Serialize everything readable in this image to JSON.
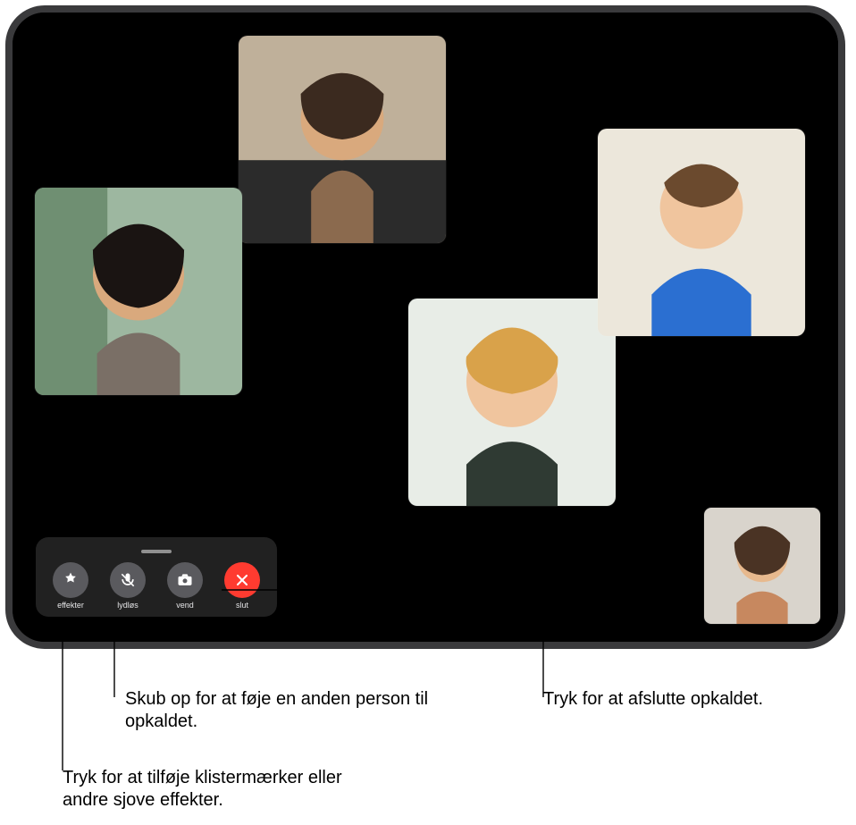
{
  "controls": {
    "effects": {
      "label": "effekter",
      "icon": "star-swirl-icon"
    },
    "mute": {
      "label": "lydløs",
      "icon": "mic-slash-icon"
    },
    "flip": {
      "label": "vend",
      "icon": "camera-flip-icon"
    },
    "end": {
      "label": "slut",
      "icon": "x-icon",
      "color": "#ff3b30"
    }
  },
  "participants": {
    "p1": {
      "desc": "participant-top"
    },
    "p2": {
      "desc": "participant-left"
    },
    "p3": {
      "desc": "participant-center"
    },
    "p4": {
      "desc": "participant-right"
    },
    "self": {
      "desc": "self-view"
    }
  },
  "annotations": {
    "effects": "Tryk for at tilføje klistermærker eller andre sjove effekter.",
    "add_person": "Skub op for at føje en anden person til opkaldet.",
    "end_call": "Tryk for at afslutte opkaldet."
  }
}
